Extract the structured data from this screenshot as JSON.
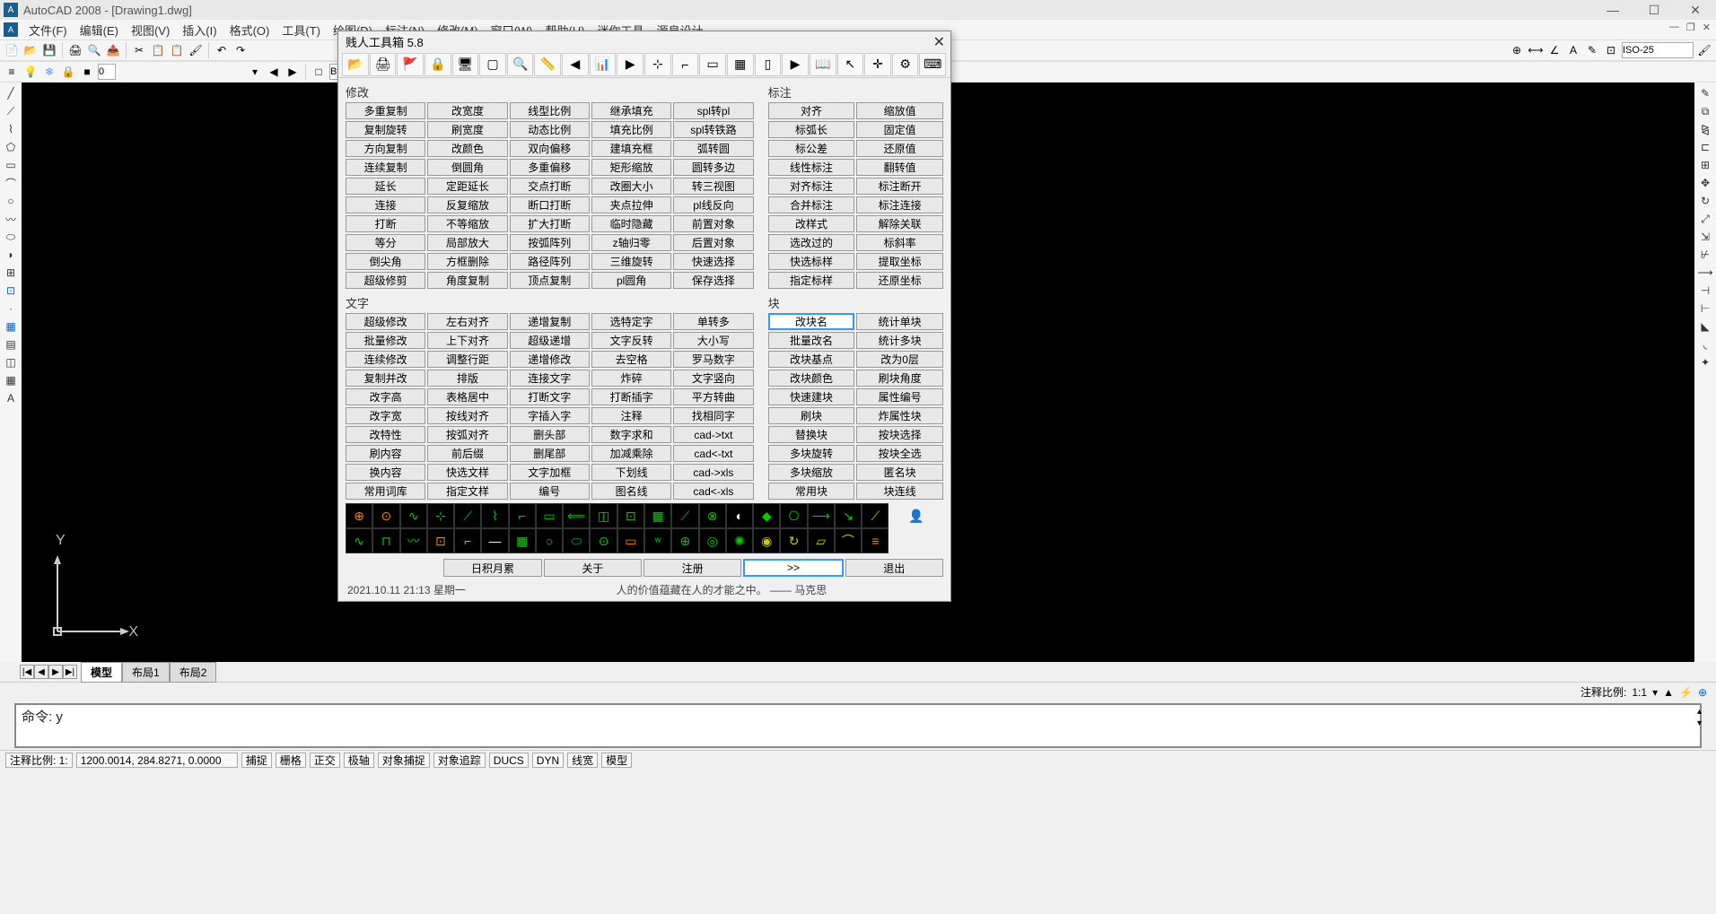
{
  "app": {
    "title": "AutoCAD 2008 - [Drawing1.dwg]",
    "icon_letter": "A"
  },
  "menu": [
    "文件(F)",
    "编辑(E)",
    "视图(V)",
    "插入(I)",
    "格式(O)",
    "工具(T)",
    "绘图(D)",
    "标注(N)",
    "修改(M)",
    "窗口(W)",
    "帮助(H)",
    "迷你工具",
    "源泉设计"
  ],
  "second_toolbar": {
    "bylayer": "ByLa",
    "iso": "ISO-25"
  },
  "layout": {
    "tabs": [
      "模型",
      "布局1",
      "布局2"
    ]
  },
  "anno": {
    "label": "注释比例:",
    "value": "1:1"
  },
  "command": {
    "prompt": "命令: y"
  },
  "status": {
    "left_text": "注释比例: 1:",
    "coords": "1200.0014, 284.8271, 0.0000",
    "buttons": [
      "捕捉",
      "栅格",
      "正交",
      "极轴",
      "对象捕捉",
      "对象追踪",
      "DUCS",
      "DYN",
      "线宽",
      "模型"
    ]
  },
  "dialog": {
    "title": "贱人工具箱 5.8",
    "sections": {
      "modify": {
        "label": "修改",
        "buttons": [
          "多重复制",
          "改宽度",
          "线型比例",
          "继承填充",
          "spl转pl",
          "复制旋转",
          "刷宽度",
          "动态比例",
          "填充比例",
          "spl转铁路",
          "方向复制",
          "改颜色",
          "双向偏移",
          "建填充框",
          "弧转圆",
          "连续复制",
          "倒圆角",
          "多重偏移",
          "矩形缩放",
          "圆转多边",
          "延长",
          "定距延长",
          "交点打断",
          "改圈大小",
          "转三视图",
          "连接",
          "反复缩放",
          "断口打断",
          "夹点拉伸",
          "pl线反向",
          "打断",
          "不等缩放",
          "扩大打断",
          "临时隐藏",
          "前置对象",
          "等分",
          "局部放大",
          "按弧阵列",
          "z轴归零",
          "后置对象",
          "倒尖角",
          "方框删除",
          "路径阵列",
          "三维旋转",
          "快速选择",
          "超级修剪",
          "角度复制",
          "顶点复制",
          "pl圆角",
          "保存选择"
        ]
      },
      "dim": {
        "label": "标注",
        "buttons": [
          "对齐",
          "缩放值",
          "标弧长",
          "固定值",
          "标公差",
          "还原值",
          "线性标注",
          "翻转值",
          "对齐标注",
          "标注断开",
          "合并标注",
          "标注连接",
          "改样式",
          "解除关联",
          "选改过的",
          "标斜率",
          "快选标样",
          "提取坐标",
          "指定标样",
          "还原坐标"
        ]
      },
      "text": {
        "label": "文字",
        "buttons": [
          "超级修改",
          "左右对齐",
          "递增复制",
          "选特定字",
          "单转多",
          "批量修改",
          "上下对齐",
          "超级递增",
          "文字反转",
          "大小写",
          "连续修改",
          "调整行距",
          "递增修改",
          "去空格",
          "罗马数字",
          "复制并改",
          "排版",
          "连接文字",
          "炸碎",
          "文字竖向",
          "改字高",
          "表格居中",
          "打断文字",
          "打断插字",
          "平方转曲",
          "改字宽",
          "按线对齐",
          "字插入字",
          "注释",
          "找相同字",
          "改特性",
          "按弧对齐",
          "删头部",
          "数字求和",
          "cad->txt",
          "刷内容",
          "前后缀",
          "删尾部",
          "加减乘除",
          "cad<-txt",
          "换内容",
          "快选文样",
          "文字加框",
          "下划线",
          "cad->xls",
          "常用词库",
          "指定文样",
          "编号",
          "图名线",
          "cad<-xls"
        ]
      },
      "block": {
        "label": "块",
        "buttons": [
          "改块名",
          "统计单块",
          "批量改名",
          "统计多块",
          "改块基点",
          "改为0层",
          "改块颜色",
          "刷块角度",
          "快速建块",
          "属性编号",
          "刷块",
          "炸属性块",
          "替换块",
          "按块选择",
          "多块旋转",
          "按块全选",
          "多块缩放",
          "匿名块",
          "常用块",
          "块连线"
        ]
      }
    },
    "footer_buttons": [
      "日积月累",
      "关于",
      "注册",
      ">>",
      "退出"
    ],
    "status_line": {
      "datetime": "2021.10.11   21:13   星期一",
      "quote": "人的价值蕴藏在人的才能之中。 —— 马克思"
    }
  }
}
